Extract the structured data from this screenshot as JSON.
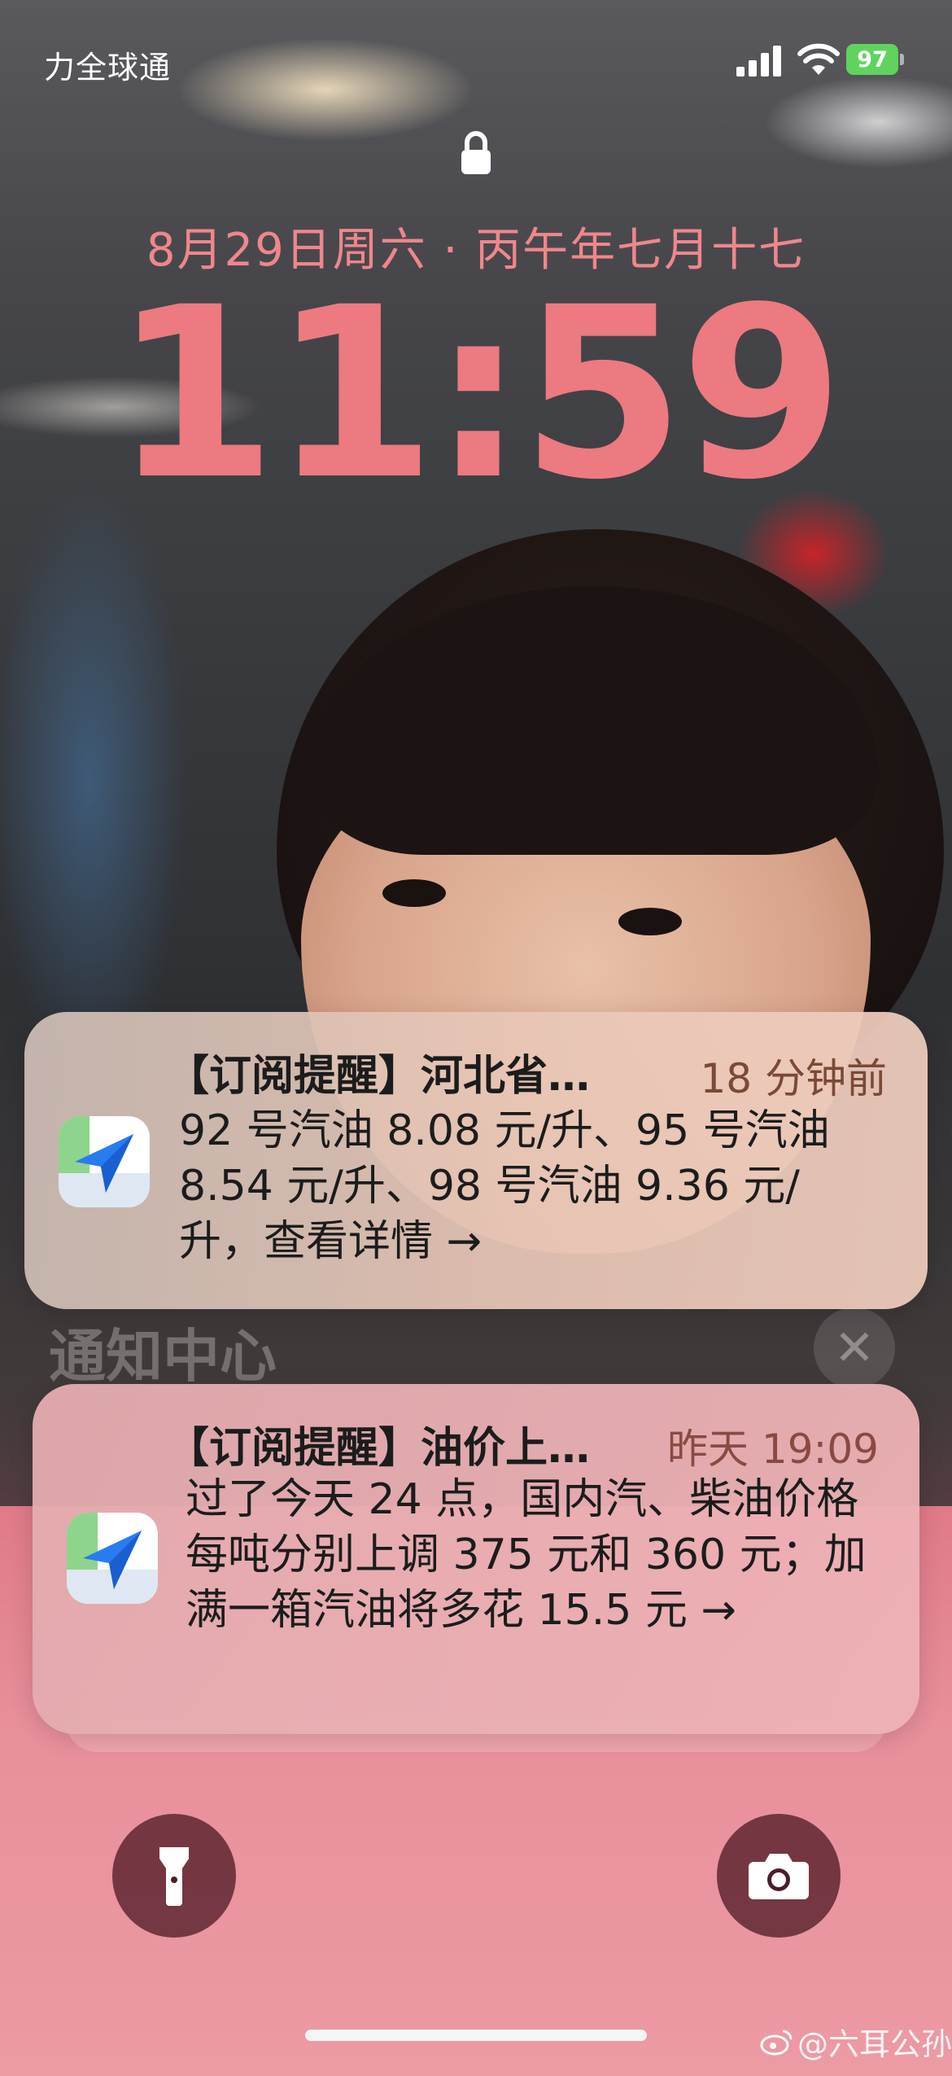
{
  "status_bar": {
    "carrier": "力全球通",
    "battery": "97"
  },
  "lock_screen": {
    "date": "8月29日周六 · 丙午年七月十七",
    "time": "11:59"
  },
  "notification_center": {
    "label": "通知中心",
    "clear_glyph": "✕"
  },
  "notifications": [
    {
      "app_icon": "amap-navigation-icon",
      "title": "【订阅提醒】河北省…",
      "time": "18 分钟前",
      "body": "92 号汽油 8.08 元/升、95 号汽油 8.54 元/升、98 号汽油 9.36 元/升，查看详情 →"
    },
    {
      "app_icon": "amap-navigation-icon",
      "title": "【订阅提醒】油价上…",
      "time": "昨天 19:09",
      "body": "过了今天 24 点，国内汽、柴油价格每吨分别上调 375 元和 360 元；加满一箱汽油将多花 15.5 元 →"
    }
  ],
  "quick_actions": {
    "left": "flashlight-icon",
    "right": "camera-icon"
  },
  "watermark": {
    "text": "@六耳公孙"
  },
  "colors": {
    "date_time": "#ec7a80",
    "battery": "#5fd35e",
    "notif_time": "#7a4a36"
  }
}
